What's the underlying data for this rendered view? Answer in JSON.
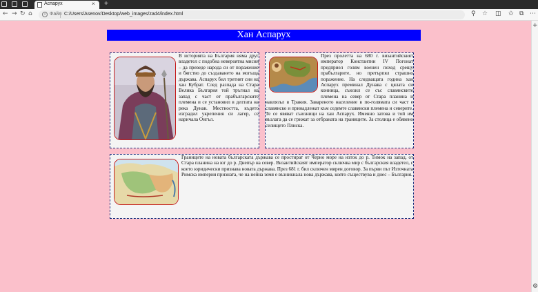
{
  "browser": {
    "tab_title": "Аспарух",
    "tab_close": "×",
    "new_tab": "+",
    "file_label": "Файл",
    "url": "C:/Users/Asenov/Desktop/web_images/zad4/index.html",
    "nav_back": "←",
    "nav_forward": "→",
    "nav_refresh": "↻",
    "nav_home": "⌂"
  },
  "page": {
    "title": "Хан Аспарух",
    "sections": [
      {
        "image_alt": "Хан Аспарух",
        "text": "В историята на България няма друг владетел с подобна невероятна мисия – да преведе народа си от поражение и бягство до създаването на могъща държава. Аспарух бил третият син на хан Кубрат. След разпада на Стара Велика България той тръгнал на запад с част от прабългарските племена и се установил в делтата на река Дунав. Местността, където изградил укрепения си лагер, се наричала Онгъл."
      },
      {
        "image_alt": "Карта на похода",
        "text": "През пролетта на 680 г. византийският император Константин IV Погонат предприел голям военен поход срещу прабългарите, но претърпял страшно поражение. На следващата година хан Аспарух преминал Дунава с цялата си конница, съюзил се със славянските племена на север от Стара планина и навлязъл в Тракия. Завареното население в по-голямата си част е славянско и принадлежат към седемте славянски племена и северите. Те се явяват съюзници на хан Аспарух. Именно затова и той им възлага да се грижат за отбраната на границите. За столица е обявено селището Плиска."
      },
      {
        "image_alt": "Карта на границите",
        "text": "Границите на новата българската държава се простират от Черно море на изток до р. Тимок на запад, от Стара планина на юг до р. Днепър на север. Византийският император сключва мир с българския владетел, с което юридически признава новата държава. През 681 г. бил сключен мирен договор. За първи път Източната Римска империя призната, че на нейна земя е възникнала нова държава, която съществува и днес – България."
      }
    ]
  },
  "colors": {
    "page_background": "#fbc0cb",
    "header_background": "#0000ff",
    "card_border": "#1a2b7a",
    "image_border": "#c41a1a"
  }
}
